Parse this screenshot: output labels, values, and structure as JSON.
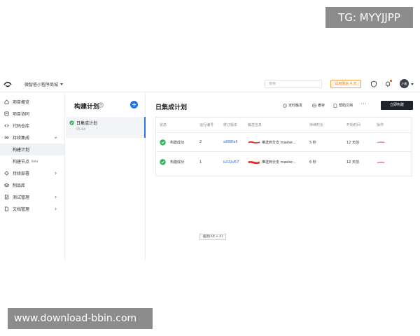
{
  "watermarks": {
    "top": "TG: MYYJJPP",
    "bottom": "www.download-bbin.com"
  },
  "header": {
    "project_name": "微智搭小程序商城",
    "search_placeholder": "搜索",
    "trial_badge": "试用剩余 4 天",
    "avatar_text": "小雅"
  },
  "sidebar": {
    "items": [
      {
        "label": "项目概览",
        "icon": "home-icon"
      },
      {
        "label": "项目协同",
        "icon": "collaboration-icon"
      },
      {
        "label": "代码仓库",
        "icon": "code-icon"
      },
      {
        "label": "持续集成",
        "icon": "infinity-icon",
        "expanded": true,
        "children": [
          {
            "label": "构建计划",
            "active": true
          },
          {
            "label": "构建节点",
            "tag": "Beta"
          }
        ]
      },
      {
        "label": "持续部署",
        "icon": "deploy-icon"
      },
      {
        "label": "制品库",
        "icon": "artifact-icon"
      },
      {
        "label": "测试管理",
        "icon": "test-icon"
      },
      {
        "label": "文档管理",
        "icon": "document-icon"
      }
    ]
  },
  "plans": {
    "title": "构建计划",
    "list": [
      {
        "name": "日集成计划",
        "date": "05-04",
        "status": "success"
      }
    ]
  },
  "main": {
    "title": "日集成计划",
    "actions": {
      "trigger": "定时触发",
      "cache": "缓存",
      "help": "帮助文档",
      "more": "···",
      "build": "立即构建"
    },
    "table": {
      "columns": [
        "状态",
        "运行编号",
        "修订版本",
        "触发信息",
        "持续时长",
        "开始时间",
        "操作"
      ],
      "rows": [
        {
          "status": "构建成功",
          "run": "2",
          "revision": "a888fa6",
          "trigger": "推送到分支 master...",
          "duration": "5 秒",
          "start": "12 天前"
        },
        {
          "status": "构建成功",
          "run": "1",
          "revision": "b222d57",
          "trigger": "推送到分支 master...",
          "duration": "6 秒",
          "start": "12 天前"
        }
      ]
    }
  },
  "tooltip": "截图(Alt + A)",
  "colors": {
    "accent": "#2a73e6",
    "success": "#33b15a",
    "primary_button": "#1d222b",
    "trial": "#f08c1f",
    "redaction": "#e0231a"
  }
}
